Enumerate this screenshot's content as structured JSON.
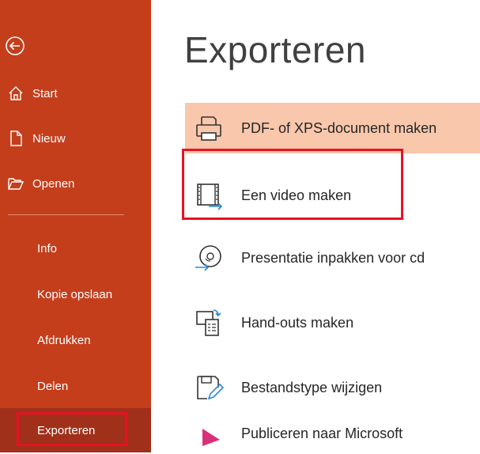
{
  "colors": {
    "sidebar": "#c43e1c",
    "selected": "#a0301a",
    "highlight": "#f9c7ab",
    "annotation": "#e81123"
  },
  "sidebar": {
    "back_icon": "back-arrow-icon",
    "top_items": [
      {
        "label": "Start",
        "icon": "home-icon"
      },
      {
        "label": "Nieuw",
        "icon": "new-document-icon"
      },
      {
        "label": "Openen",
        "icon": "folder-open-icon"
      }
    ],
    "sub_items": [
      {
        "label": "Info"
      },
      {
        "label": "Kopie opslaan"
      },
      {
        "label": "Afdrukken"
      },
      {
        "label": "Delen"
      },
      {
        "label": "Exporteren"
      }
    ],
    "selected": "Exporteren"
  },
  "main": {
    "title": "Exporteren",
    "options": [
      {
        "label": "PDF- of XPS-document maken",
        "icon": "pdf-document-icon"
      },
      {
        "label": "Een video maken",
        "icon": "video-icon"
      },
      {
        "label": "Presentatie inpakken voor cd",
        "icon": "cd-package-icon"
      },
      {
        "label": "Hand-outs maken",
        "icon": "handouts-icon"
      },
      {
        "label": "Bestandstype wijzigen",
        "icon": "change-file-type-icon"
      },
      {
        "label": "Publiceren naar Microsoft",
        "icon": "publish-icon"
      }
    ]
  }
}
